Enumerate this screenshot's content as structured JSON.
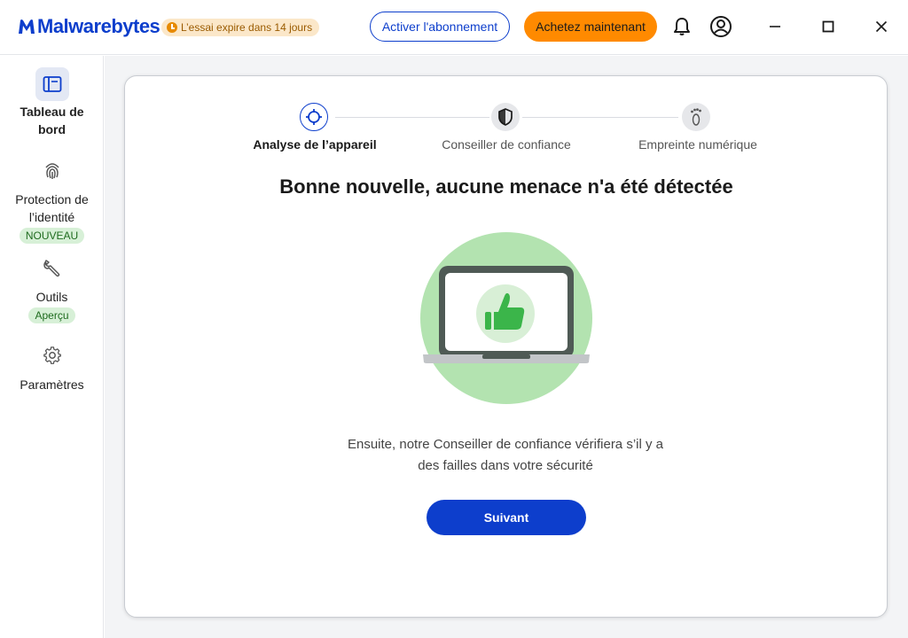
{
  "app": {
    "logo_bold": "Malwarebytes",
    "logo_light": "",
    "trial_badge": "L’essai expire dans 14 jours"
  },
  "header": {
    "activate_label": "Activer l'abonnement",
    "buy_label": "Achetez maintenant",
    "icons": [
      "bell-icon",
      "account-icon"
    ],
    "window_controls": [
      "minimize-icon",
      "maximize-icon",
      "close-icon"
    ]
  },
  "sidebar": {
    "items": [
      {
        "label_line1": "Tableau de",
        "label_line2": "bord",
        "icon": "dashboard-icon",
        "active": true,
        "badge": ""
      },
      {
        "label_line1": "Protection de",
        "label_line2": "l’identité",
        "icon": "fingerprint-icon",
        "active": false,
        "badge": "NOUVEAU"
      },
      {
        "label_line1": "Outils",
        "label_line2": "",
        "icon": "wrench-icon",
        "active": false,
        "badge": "Aperçu"
      },
      {
        "label_line1": "Paramètres",
        "label_line2": "",
        "icon": "gear-icon",
        "active": false,
        "badge": ""
      }
    ]
  },
  "stepper": {
    "steps": [
      {
        "label": "Analyse de l’appareil",
        "icon": "crosshair-icon",
        "active": true
      },
      {
        "label": "Conseiller de confiance",
        "icon": "shield-icon",
        "active": false
      },
      {
        "label": "Empreinte numérique",
        "icon": "footprint-icon",
        "active": false
      }
    ]
  },
  "main": {
    "headline": "Bonne nouvelle, aucune menace n'a été détectée",
    "subtext_line1": "Ensuite, notre Conseiller de confiance vérifiera s’il y a",
    "subtext_line2": "des failles dans votre sécurité",
    "next_label": "Suivant"
  },
  "colors": {
    "brand_blue": "#0d3ecc",
    "orange": "#ff8a00",
    "success_green": "#3bb54a",
    "illustration_bg": "#b3e3b0"
  }
}
